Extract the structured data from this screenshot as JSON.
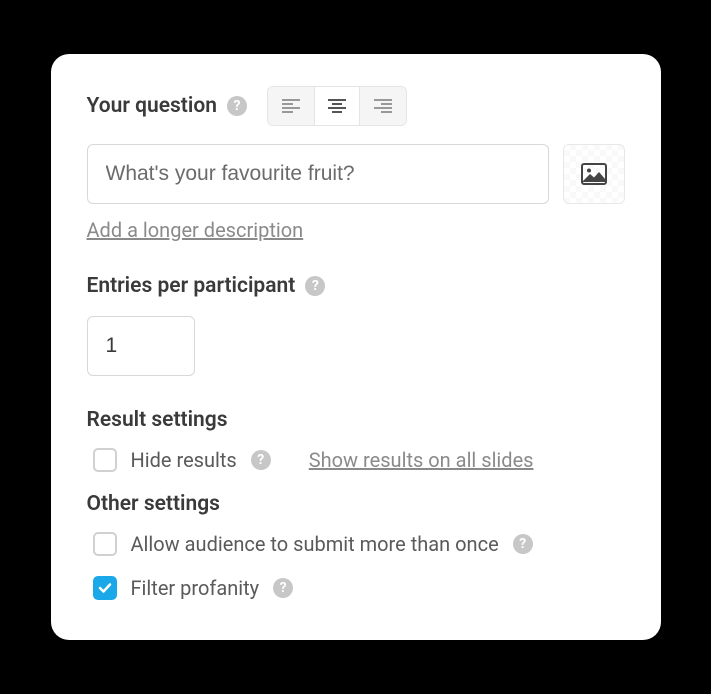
{
  "question": {
    "label": "Your question",
    "value": "What's your favourite fruit?",
    "description_link": "Add a longer description"
  },
  "entries": {
    "label": "Entries per participant",
    "value": "1"
  },
  "result_settings": {
    "heading": "Result settings",
    "hide_results_label": "Hide results",
    "hide_results_checked": false,
    "show_all_link": "Show results on all slides"
  },
  "other_settings": {
    "heading": "Other settings",
    "allow_multiple_label": "Allow audience to submit more than once",
    "allow_multiple_checked": false,
    "filter_profanity_label": "Filter profanity",
    "filter_profanity_checked": true
  }
}
